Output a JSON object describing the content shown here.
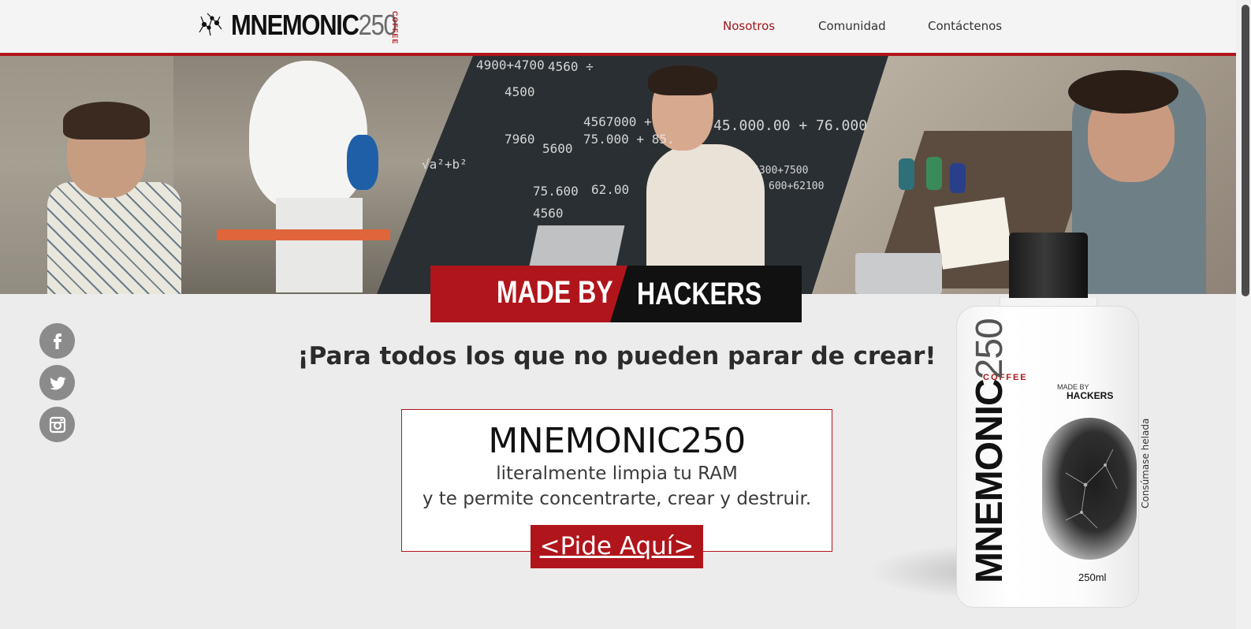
{
  "header": {
    "logo_text": "MNEMONIC",
    "logo_number": "250",
    "logo_sub": "COFFEE",
    "nav": [
      {
        "label": "Nosotros",
        "active": true
      },
      {
        "label": "Comunidad",
        "active": false
      },
      {
        "label": "Contáctenos",
        "active": false
      }
    ]
  },
  "hero": {
    "badge_left": "MADE BY",
    "badge_right": "HACKERS",
    "chalk": [
      "4900+4700",
      "4560 ÷",
      "4500",
      "4567000 +",
      "75.000 + 85.",
      "45.000.00 + 76.000",
      "75.600",
      "62.00",
      "4560",
      "5600",
      "4300+7500",
      "600+62100",
      "7960",
      "√a²+b²"
    ]
  },
  "social": [
    {
      "name": "facebook-icon",
      "label": "f"
    },
    {
      "name": "twitter-icon",
      "label": "twitter"
    },
    {
      "name": "instagram-icon",
      "label": "instagram"
    }
  ],
  "content": {
    "tagline": "¡Para todos los que no pueden parar de crear!",
    "promo_title": "MNEMONIC250",
    "promo_line1": "literalmente limpia tu RAM",
    "promo_line2": "y te permite concentrarte, crear y destruir.",
    "cta": "<Pide Aquí>"
  },
  "product": {
    "coffee": "COFFEE",
    "brand": "MNEMONIC",
    "number": "250",
    "made_by": "MADE BY",
    "hackers": "HACKERS",
    "volume": "250ml",
    "side_text": "Consúmase helada"
  },
  "colors": {
    "accent": "#b0151b",
    "background": "#ececec",
    "header": "#f4f4f4"
  }
}
